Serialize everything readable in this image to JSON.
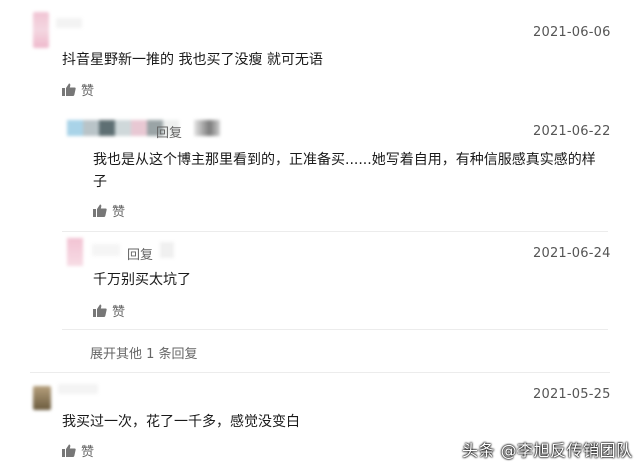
{
  "comments": [
    {
      "date": "2021-06-06",
      "text": "抖音星野新一推的 我也买了没瘦 就可无语",
      "like_label": "赞",
      "replies": [
        {
          "reply_label": "回复",
          "date": "2021-06-22",
          "text_line1": "我也是从这个博主那里看到的，正准备买......她写着自用，有种信服感真实感的样",
          "text_line2": "子",
          "like_label": "赞"
        },
        {
          "reply_label": "回复",
          "date": "2021-06-24",
          "text": "千万别买太坑了",
          "like_label": "赞"
        }
      ],
      "expand_label": "展开其他 1 条回复"
    },
    {
      "date": "2021-05-25",
      "text": "我买过一次，花了一千多，感觉没变白",
      "like_label": "赞"
    }
  ],
  "watermark": "头条 @李旭反传销团队",
  "colors": {
    "background": "#ffffff",
    "text": "#1a1a1a",
    "muted": "#666666",
    "divider": "#ececec"
  }
}
